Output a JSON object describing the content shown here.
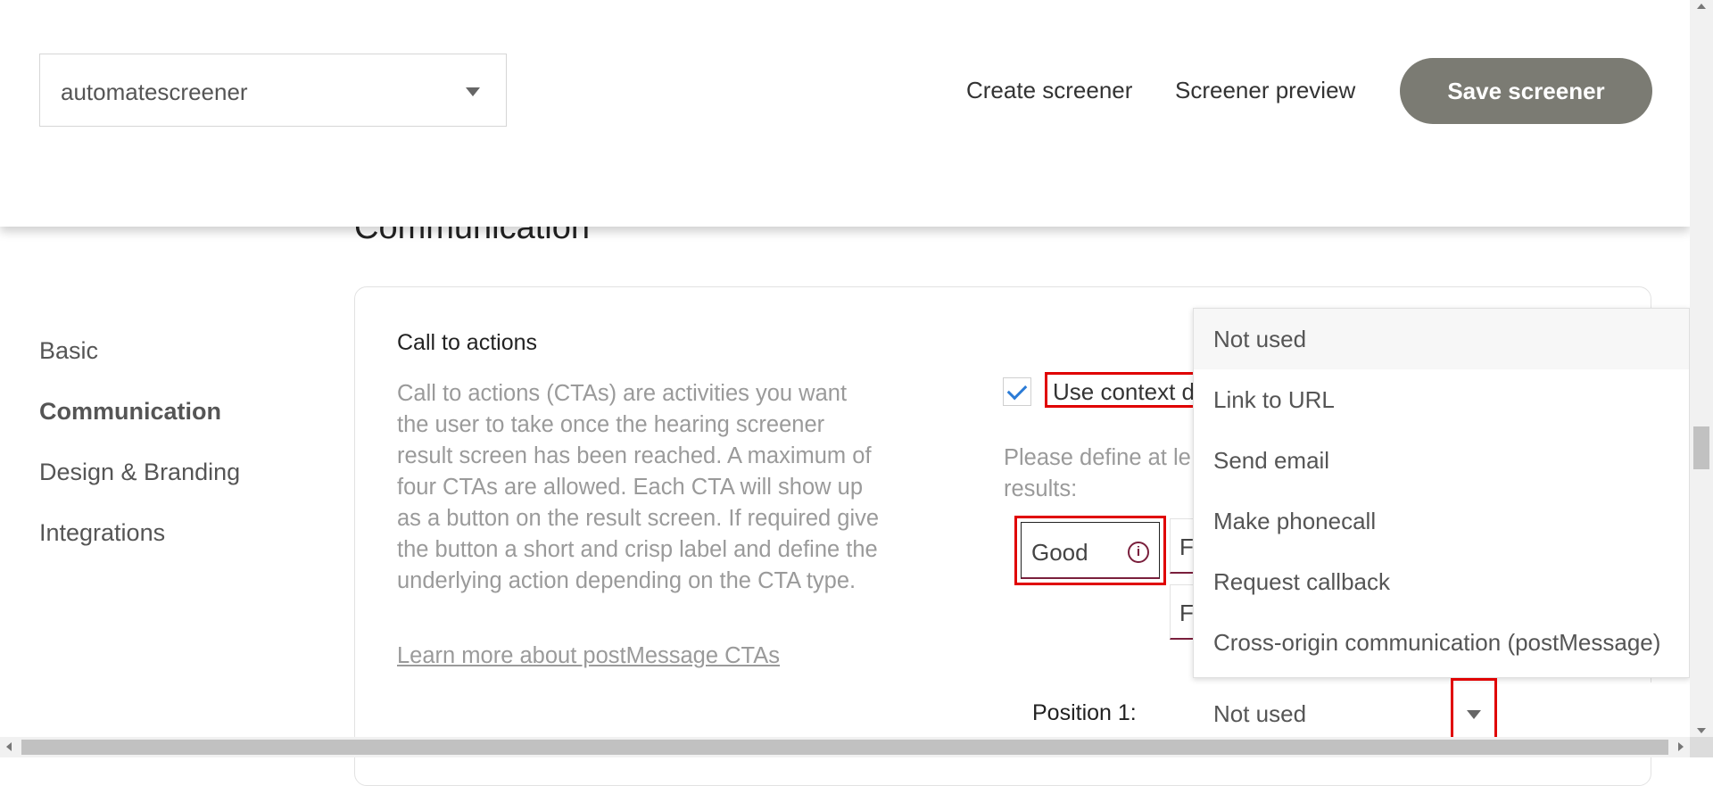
{
  "header": {
    "project_select": {
      "value": "automatescreener"
    },
    "create_link": "Create screener",
    "preview_link": "Screener preview",
    "save_button": "Save screener",
    "save_button_color": "#7b7b73"
  },
  "section_title": "Communication",
  "sidenav": {
    "items": [
      {
        "label": "Basic",
        "active": false
      },
      {
        "label": "Communication",
        "active": true
      },
      {
        "label": "Design & Branding",
        "active": false
      },
      {
        "label": "Integrations",
        "active": false
      }
    ]
  },
  "card": {
    "title": "Call to actions",
    "description": "Call to actions (CTAs) are activities you want the user to take once the hearing screener result screen has been reached. A maximum of four CTAs are allowed. Each CTA will show up as a button on the result screen. If required give the button a short and crisp label and define the underlying action depending on the CTA type.",
    "learn_more_link": "Learn more about postMessage CTAs",
    "context_checkbox": {
      "checked": true,
      "label": "Use context d"
    },
    "define_text_line1": "Please define at le",
    "define_text_line2": "results:",
    "result_tabs": [
      {
        "label": "Good",
        "icon": "info-icon"
      },
      {
        "label": "F"
      },
      {
        "label": "F"
      }
    ],
    "position_label": "Position 1:",
    "position_select_value": "Not used"
  },
  "cta_type_dropdown": {
    "options": [
      "Not used",
      "Link to URL",
      "Send email",
      "Make phonecall",
      "Request callback",
      "Cross-origin communication (postMessage)"
    ],
    "highlighted": "Not used"
  },
  "colors": {
    "highlight_border": "#e00000",
    "accent": "#7a1f3c",
    "checkbox_tick": "#2b7bd6"
  }
}
